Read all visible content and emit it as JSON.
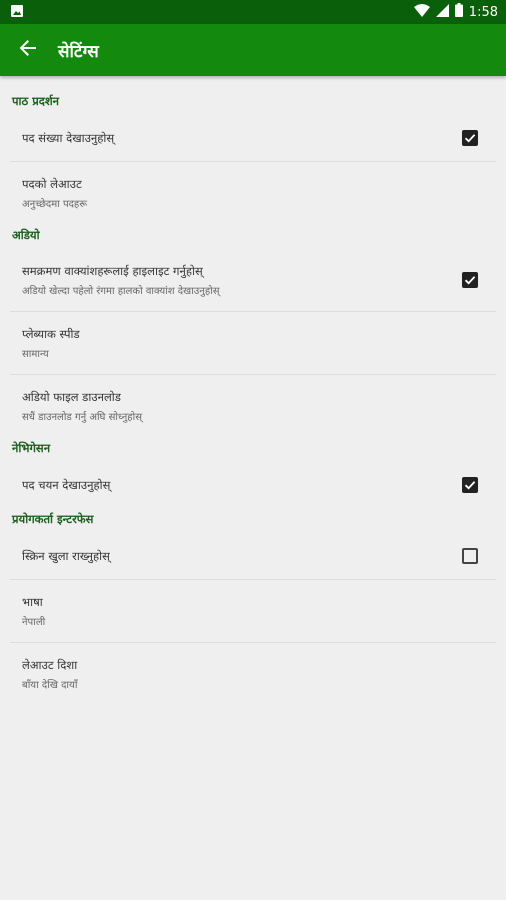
{
  "status": {
    "time": "1:58"
  },
  "app": {
    "title": "सेटिंग्स"
  },
  "sections": {
    "display": {
      "header": "पाठ प्रदर्शन",
      "show_verse_numbers": {
        "title": "पद संख्या देखाउनुहोस्",
        "checked": true
      },
      "verse_layout": {
        "title": "पदको लेआउट",
        "value": "अनुच्छेदमा पदहरू"
      }
    },
    "audio": {
      "header": "अडियो",
      "highlight": {
        "title": "समक्रमण वाक्यांशहरूलाई हाइलाइट गर्नुहोस्",
        "subtitle": "अडियो खेल्दा पहेलो रंगमा हालको वाक्यांश देखाउनुहोस्",
        "checked": true
      },
      "playback_speed": {
        "title": "प्लेब्याक स्पीड",
        "value": "सामान्य"
      },
      "download": {
        "title": "अडियो फाइल डाउनलोड",
        "value": "सधैं डाउनलोड गर्नु अघि सोध्नुहोस्"
      }
    },
    "navigation": {
      "header": "नेभिगेसन",
      "show_verse_selection": {
        "title": "पद चयन देखाउनुहोस्",
        "checked": true
      }
    },
    "interface": {
      "header": "प्रयोगकर्ता इन्टरफेस",
      "keep_screen_on": {
        "title": "स्क्रिन खुला राख्नुहोस्",
        "checked": false
      },
      "language": {
        "title": "भाषा",
        "value": "नेपाली"
      },
      "layout_direction": {
        "title": "लेआउट दिशा",
        "value": "बाँया देखि दायाँ"
      }
    }
  },
  "colors": {
    "status_bar": "#0a5f0a",
    "app_bar": "#138a0e",
    "section_header": "#1e5c1e",
    "background": "#efefef"
  }
}
